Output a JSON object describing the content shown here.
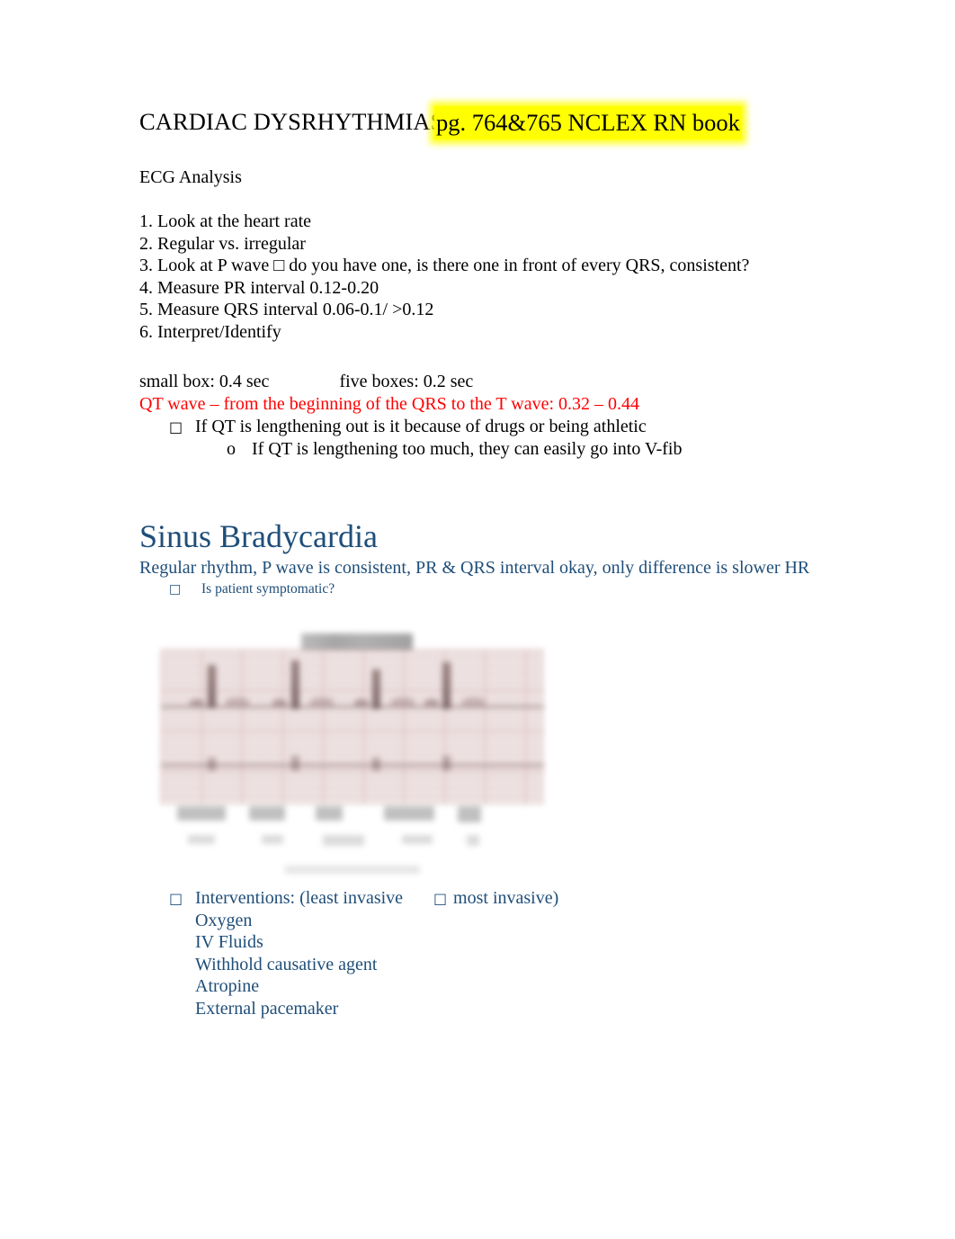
{
  "document": {
    "title_plain": "CARDIAC DYSRHYTHMIAS",
    "title_highlighted": "pg. 764&765 NCLEX RN book",
    "subhead": "ECG Analysis",
    "colors": {
      "highlight": "#ffff00",
      "red_text": "#ff0000",
      "blue_text": "#1f4e79",
      "body_text": "#000000"
    }
  },
  "ecg_analysis_steps": [
    "1. Look at the heart rate",
    "2. Regular vs. irregular",
    "3. Look at P wave □ do you have one, is there one in front of every QRS, consistent?",
    "4. Measure PR interval 0.12-0.20",
    "5. Measure QRS interval 0.06-0.1/ >0.12",
    "6. Interpret/Identify"
  ],
  "box_timing": {
    "small_box": "small box: 0.4 sec",
    "five_boxes": "five boxes: 0.2 sec"
  },
  "qt_section": {
    "headline": "QT wave – from the beginning of the QRS to the T wave: 0.32 – 0.44",
    "bullet_glyph": "□",
    "sub_bullet_glyph": "o",
    "bullet_1": "If QT is lengthening out is it because of drugs or being athletic",
    "bullet_2": "If QT is lengthening too much, they can easily go into V-fib"
  },
  "sinus_bradycardia": {
    "heading": "Sinus Bradycardia",
    "description": "Regular rhythm, P wave is consistent, PR & QRS interval okay, only difference is slower HR",
    "bullet_glyph": "□",
    "symptomatic_question": "Is patient symptomatic?",
    "interventions_label_start": "Interventions: (least invasive",
    "interventions_arrow_glyph": "□",
    "interventions_label_end": "most invasive)",
    "interventions": [
      "Oxygen",
      "IV Fluids",
      "Withhold causative agent",
      "Atropine",
      "External pacemaker"
    ]
  },
  "ecg_image": {
    "alt": "blurred sinus bradycardia ECG rhythm strip on pink graph paper"
  }
}
